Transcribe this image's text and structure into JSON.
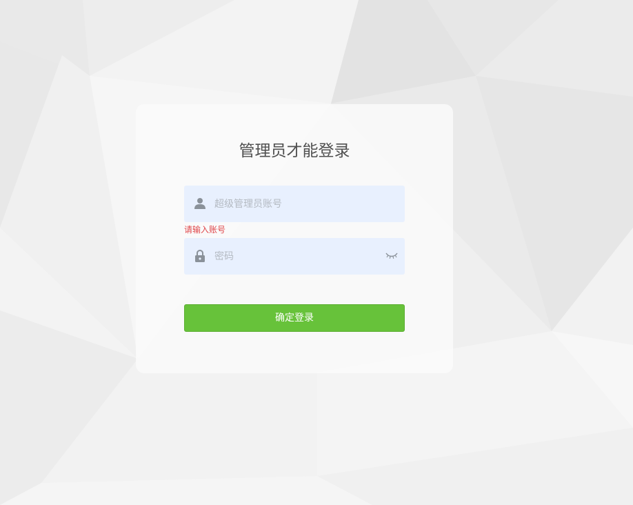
{
  "login": {
    "title": "管理员才能登录",
    "username": {
      "placeholder": "超级管理员账号",
      "value": "",
      "icon": "user-icon",
      "error": "请输入账号"
    },
    "password": {
      "placeholder": "密码",
      "value": "",
      "icon": "lock-icon",
      "toggle_icon": "eye-closed-icon"
    },
    "submit_label": "确定登录"
  },
  "colors": {
    "background": "#eeeeee",
    "input_background": "#e8f0fe",
    "button": "#67c23a",
    "error": "#e0484b",
    "icon": "#8a9199"
  }
}
